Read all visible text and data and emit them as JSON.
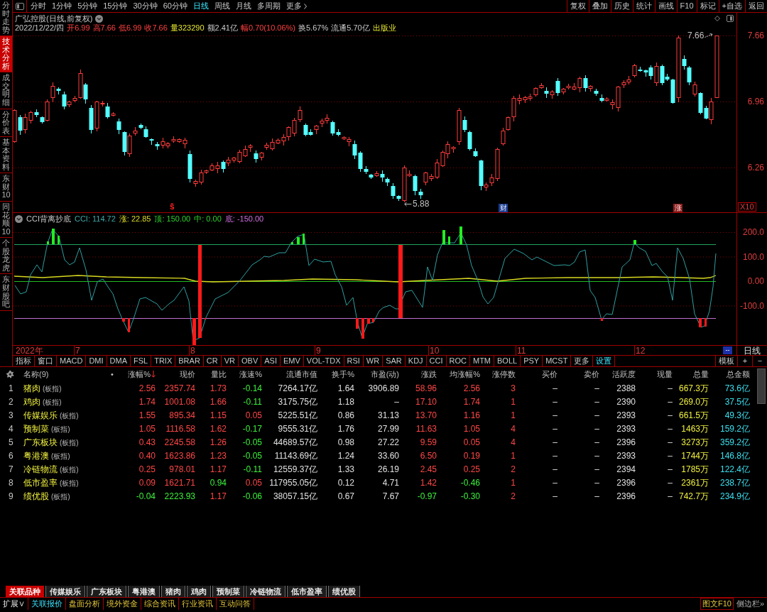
{
  "sidebar": {
    "items": [
      {
        "label": "分时走势",
        "selected": false
      },
      {
        "label": "技术分析",
        "selected": true
      },
      {
        "label": "成交明细",
        "selected": false
      },
      {
        "label": "分价表",
        "selected": false
      },
      {
        "label": "基本资料",
        "selected": false
      },
      {
        "label": "东财10",
        "selected": false
      },
      {
        "label": "同花顺10",
        "selected": false
      },
      {
        "label": "个股龙虎",
        "selected": false
      },
      {
        "label": "东财股吧",
        "selected": false
      }
    ]
  },
  "period_bar": {
    "periods": [
      {
        "label": "分时",
        "selected": false
      },
      {
        "label": "1分钟",
        "selected": false
      },
      {
        "label": "5分钟",
        "selected": false
      },
      {
        "label": "15分钟",
        "selected": false
      },
      {
        "label": "30分钟",
        "selected": false
      },
      {
        "label": "60分钟",
        "selected": false
      },
      {
        "label": "日线",
        "selected": true
      },
      {
        "label": "周线",
        "selected": false
      },
      {
        "label": "月线",
        "selected": false
      },
      {
        "label": "多周期",
        "selected": false
      }
    ],
    "more": "更多",
    "tools": [
      "复权",
      "叠加",
      "历史",
      "统计",
      "画线",
      "F10",
      "标记",
      "+自选",
      "返回"
    ]
  },
  "quote": {
    "title": "广弘控股(日线,前复权)",
    "date": "2022/12/22/四",
    "fields": [
      {
        "text": "开6.99",
        "kind": "up"
      },
      {
        "text": "高7.66",
        "kind": "up"
      },
      {
        "text": "低6.99",
        "kind": "up"
      },
      {
        "text": "收7.66",
        "kind": "up"
      },
      {
        "text": "量323290",
        "kind": "volume"
      },
      {
        "text": "额2.41亿",
        "kind": "plain"
      },
      {
        "text": "幅0.70(10.06%)",
        "kind": "up"
      },
      {
        "text": "换5.67%",
        "kind": "plain"
      },
      {
        "text": "流通5.70亿",
        "kind": "plain"
      },
      {
        "text": "出版业",
        "kind": "industry"
      }
    ]
  },
  "price_chart": {
    "axis": [
      "7.66",
      "6.96",
      "6.26"
    ],
    "high_label": "7.66",
    "low_label": "5.88",
    "markers": [
      {
        "text": "ŝ",
        "kind": "signal"
      },
      {
        "text": "财",
        "kind": "finance"
      },
      {
        "text": "涨",
        "kind": "rise"
      }
    ],
    "scale": "X10"
  },
  "indicator": {
    "name": "CCI背离抄底",
    "readings": [
      {
        "text": "CCI: 114.72",
        "kind": "cci"
      },
      {
        "text": "涨: 22.85",
        "kind": "rise"
      },
      {
        "text": "顶: 150.00",
        "kind": "top"
      },
      {
        "text": "中: 0.00",
        "kind": "middle"
      },
      {
        "text": "底: -150.00",
        "kind": "bottom"
      }
    ],
    "axis": [
      "200.0",
      "100.0",
      "0.00",
      "-100.0"
    ]
  },
  "time_axis": {
    "labels": [
      "2022年",
      "7",
      "8",
      "9",
      "10",
      "11",
      "12"
    ],
    "cursor": "--",
    "period": "日线"
  },
  "indicator_bar": {
    "tabs": [
      "指标",
      "窗口",
      "MACD",
      "DMI",
      "DMA",
      "FSL",
      "TRIX",
      "BRAR",
      "CR",
      "VR",
      "OBV",
      "ASI",
      "EMV",
      "VOL-TDX",
      "RSI",
      "WR",
      "SAR",
      "KDJ",
      "CCI",
      "ROC",
      "MTM",
      "BOLL",
      "PSY",
      "MCST",
      "更多"
    ],
    "settings": "设置",
    "right": [
      "模板",
      "+",
      "−"
    ]
  },
  "table": {
    "name_header": "名称(9)",
    "marker_header": "•",
    "columns": [
      {
        "label": "涨幅%",
        "sorted": true
      },
      {
        "label": "现价",
        "sorted": false
      },
      {
        "label": "量比",
        "sorted": false
      },
      {
        "label": "涨速%",
        "sorted": false
      },
      {
        "label": "流通市值",
        "sorted": false
      },
      {
        "label": "换手%",
        "sorted": false
      },
      {
        "label": "市盈(动)",
        "sorted": false
      },
      {
        "label": "涨跌",
        "sorted": false
      },
      {
        "label": "均涨幅%",
        "sorted": false
      },
      {
        "label": "涨停数",
        "sorted": false
      },
      {
        "label": "买价",
        "sorted": false
      },
      {
        "label": "卖价",
        "sorted": false
      },
      {
        "label": "活跃度",
        "sorted": false
      },
      {
        "label": "现量",
        "sorted": false
      },
      {
        "label": "总量",
        "sorted": false
      },
      {
        "label": "总金额",
        "sorted": false
      }
    ],
    "rows": [
      {
        "index": "1",
        "name": "猪肉",
        "tag": "(板指)",
        "cells": [
          {
            "text": "2.56",
            "kind": "up"
          },
          {
            "text": "2357.74",
            "kind": "up"
          },
          {
            "text": "1.73",
            "kind": "up"
          },
          {
            "text": "-0.14",
            "kind": "down"
          },
          {
            "text": "7264.17亿",
            "kind": "plain"
          },
          {
            "text": "1.64",
            "kind": "plain"
          },
          {
            "text": "3906.89",
            "kind": "plain"
          },
          {
            "text": "58.96",
            "kind": "up"
          },
          {
            "text": "2.56",
            "kind": "up"
          },
          {
            "text": "3",
            "kind": "up"
          },
          {
            "text": "–",
            "kind": "plain"
          },
          {
            "text": "–",
            "kind": "plain"
          },
          {
            "text": "2388",
            "kind": "plain"
          },
          {
            "text": "–",
            "kind": "plain"
          },
          {
            "text": "667.3万",
            "kind": "volume"
          },
          {
            "text": "73.6亿",
            "kind": "amount"
          }
        ]
      },
      {
        "index": "2",
        "name": "鸡肉",
        "tag": "(板指)",
        "cells": [
          {
            "text": "1.74",
            "kind": "up"
          },
          {
            "text": "1001.08",
            "kind": "up"
          },
          {
            "text": "1.66",
            "kind": "up"
          },
          {
            "text": "-0.11",
            "kind": "down"
          },
          {
            "text": "3175.75亿",
            "kind": "plain"
          },
          {
            "text": "1.18",
            "kind": "plain"
          },
          {
            "text": "–",
            "kind": "plain"
          },
          {
            "text": "17.10",
            "kind": "up"
          },
          {
            "text": "1.74",
            "kind": "up"
          },
          {
            "text": "1",
            "kind": "up"
          },
          {
            "text": "–",
            "kind": "plain"
          },
          {
            "text": "–",
            "kind": "plain"
          },
          {
            "text": "2390",
            "kind": "plain"
          },
          {
            "text": "–",
            "kind": "plain"
          },
          {
            "text": "269.0万",
            "kind": "volume"
          },
          {
            "text": "37.5亿",
            "kind": "amount"
          }
        ]
      },
      {
        "index": "3",
        "name": "传媒娱乐",
        "tag": "(板指)",
        "cells": [
          {
            "text": "1.55",
            "kind": "up"
          },
          {
            "text": "895.34",
            "kind": "up"
          },
          {
            "text": "1.15",
            "kind": "up"
          },
          {
            "text": "0.05",
            "kind": "up"
          },
          {
            "text": "5225.51亿",
            "kind": "plain"
          },
          {
            "text": "0.86",
            "kind": "plain"
          },
          {
            "text": "31.13",
            "kind": "plain"
          },
          {
            "text": "13.70",
            "kind": "up"
          },
          {
            "text": "1.16",
            "kind": "up"
          },
          {
            "text": "1",
            "kind": "up"
          },
          {
            "text": "–",
            "kind": "plain"
          },
          {
            "text": "–",
            "kind": "plain"
          },
          {
            "text": "2393",
            "kind": "plain"
          },
          {
            "text": "–",
            "kind": "plain"
          },
          {
            "text": "661.5万",
            "kind": "volume"
          },
          {
            "text": "49.3亿",
            "kind": "amount"
          }
        ]
      },
      {
        "index": "4",
        "name": "预制菜",
        "tag": "(板指)",
        "cells": [
          {
            "text": "1.05",
            "kind": "up"
          },
          {
            "text": "1116.58",
            "kind": "up"
          },
          {
            "text": "1.62",
            "kind": "up"
          },
          {
            "text": "-0.17",
            "kind": "down"
          },
          {
            "text": "9555.31亿",
            "kind": "plain"
          },
          {
            "text": "1.76",
            "kind": "plain"
          },
          {
            "text": "27.99",
            "kind": "plain"
          },
          {
            "text": "11.63",
            "kind": "up"
          },
          {
            "text": "1.05",
            "kind": "up"
          },
          {
            "text": "4",
            "kind": "up"
          },
          {
            "text": "–",
            "kind": "plain"
          },
          {
            "text": "–",
            "kind": "plain"
          },
          {
            "text": "2393",
            "kind": "plain"
          },
          {
            "text": "–",
            "kind": "plain"
          },
          {
            "text": "1463万",
            "kind": "volume"
          },
          {
            "text": "159.2亿",
            "kind": "amount"
          }
        ]
      },
      {
        "index": "5",
        "name": "广东板块",
        "tag": "(板指)",
        "cells": [
          {
            "text": "0.43",
            "kind": "up"
          },
          {
            "text": "2245.58",
            "kind": "up"
          },
          {
            "text": "1.26",
            "kind": "up"
          },
          {
            "text": "-0.05",
            "kind": "down"
          },
          {
            "text": "44689.57亿",
            "kind": "plain"
          },
          {
            "text": "0.98",
            "kind": "plain"
          },
          {
            "text": "27.22",
            "kind": "plain"
          },
          {
            "text": "9.59",
            "kind": "up"
          },
          {
            "text": "0.05",
            "kind": "up"
          },
          {
            "text": "4",
            "kind": "up"
          },
          {
            "text": "–",
            "kind": "plain"
          },
          {
            "text": "–",
            "kind": "plain"
          },
          {
            "text": "2396",
            "kind": "plain"
          },
          {
            "text": "–",
            "kind": "plain"
          },
          {
            "text": "3273万",
            "kind": "volume"
          },
          {
            "text": "359.2亿",
            "kind": "amount"
          }
        ]
      },
      {
        "index": "6",
        "name": "粤港澳",
        "tag": "(板指)",
        "cells": [
          {
            "text": "0.40",
            "kind": "up"
          },
          {
            "text": "1623.86",
            "kind": "up"
          },
          {
            "text": "1.23",
            "kind": "up"
          },
          {
            "text": "-0.05",
            "kind": "down"
          },
          {
            "text": "11143.69亿",
            "kind": "plain"
          },
          {
            "text": "1.24",
            "kind": "plain"
          },
          {
            "text": "33.60",
            "kind": "plain"
          },
          {
            "text": "6.50",
            "kind": "up"
          },
          {
            "text": "0.19",
            "kind": "up"
          },
          {
            "text": "1",
            "kind": "up"
          },
          {
            "text": "–",
            "kind": "plain"
          },
          {
            "text": "–",
            "kind": "plain"
          },
          {
            "text": "2393",
            "kind": "plain"
          },
          {
            "text": "–",
            "kind": "plain"
          },
          {
            "text": "1744万",
            "kind": "volume"
          },
          {
            "text": "146.8亿",
            "kind": "amount"
          }
        ]
      },
      {
        "index": "7",
        "name": "冷链物流",
        "tag": "(板指)",
        "cells": [
          {
            "text": "0.25",
            "kind": "up"
          },
          {
            "text": "978.01",
            "kind": "up"
          },
          {
            "text": "1.17",
            "kind": "up"
          },
          {
            "text": "-0.11",
            "kind": "down"
          },
          {
            "text": "12559.37亿",
            "kind": "plain"
          },
          {
            "text": "1.33",
            "kind": "plain"
          },
          {
            "text": "26.19",
            "kind": "plain"
          },
          {
            "text": "2.45",
            "kind": "up"
          },
          {
            "text": "0.25",
            "kind": "up"
          },
          {
            "text": "2",
            "kind": "up"
          },
          {
            "text": "–",
            "kind": "plain"
          },
          {
            "text": "–",
            "kind": "plain"
          },
          {
            "text": "2394",
            "kind": "plain"
          },
          {
            "text": "–",
            "kind": "plain"
          },
          {
            "text": "1785万",
            "kind": "volume"
          },
          {
            "text": "122.4亿",
            "kind": "amount"
          }
        ]
      },
      {
        "index": "8",
        "name": "低市盈率",
        "tag": "(板指)",
        "cells": [
          {
            "text": "0.09",
            "kind": "up"
          },
          {
            "text": "1621.71",
            "kind": "up"
          },
          {
            "text": "0.94",
            "kind": "down"
          },
          {
            "text": "0.05",
            "kind": "up"
          },
          {
            "text": "117955.05亿",
            "kind": "plain"
          },
          {
            "text": "0.12",
            "kind": "plain"
          },
          {
            "text": "4.71",
            "kind": "plain"
          },
          {
            "text": "1.42",
            "kind": "up"
          },
          {
            "text": "-0.46",
            "kind": "down"
          },
          {
            "text": "1",
            "kind": "up"
          },
          {
            "text": "–",
            "kind": "plain"
          },
          {
            "text": "–",
            "kind": "plain"
          },
          {
            "text": "2396",
            "kind": "plain"
          },
          {
            "text": "–",
            "kind": "plain"
          },
          {
            "text": "2361万",
            "kind": "volume"
          },
          {
            "text": "238.7亿",
            "kind": "amount"
          }
        ]
      },
      {
        "index": "9",
        "name": "绩优股",
        "tag": "(板指)",
        "cells": [
          {
            "text": "-0.04",
            "kind": "down"
          },
          {
            "text": "2223.93",
            "kind": "down"
          },
          {
            "text": "1.17",
            "kind": "up"
          },
          {
            "text": "-0.06",
            "kind": "down"
          },
          {
            "text": "38057.15亿",
            "kind": "plain"
          },
          {
            "text": "0.67",
            "kind": "plain"
          },
          {
            "text": "7.67",
            "kind": "plain"
          },
          {
            "text": "-0.97",
            "kind": "down"
          },
          {
            "text": "-0.30",
            "kind": "down"
          },
          {
            "text": "2",
            "kind": "up"
          },
          {
            "text": "–",
            "kind": "plain"
          },
          {
            "text": "–",
            "kind": "plain"
          },
          {
            "text": "2396",
            "kind": "plain"
          },
          {
            "text": "–",
            "kind": "plain"
          },
          {
            "text": "742.7万",
            "kind": "volume"
          },
          {
            "text": "234.9亿",
            "kind": "amount"
          }
        ]
      }
    ]
  },
  "bottom_tabs": [
    {
      "label": "关联品种",
      "selected": true
    },
    {
      "label": "传媒娱乐",
      "selected": false
    },
    {
      "label": "广东板块",
      "selected": false
    },
    {
      "label": "粤港澳",
      "selected": false
    },
    {
      "label": "猪肉",
      "selected": false
    },
    {
      "label": "鸡肉",
      "selected": false
    },
    {
      "label": "预制菜",
      "selected": false
    },
    {
      "label": "冷链物流",
      "selected": false
    },
    {
      "label": "低市盈率",
      "selected": false
    },
    {
      "label": "绩优股",
      "selected": false
    }
  ],
  "status_bar": {
    "menu": "扩展∨",
    "links": [
      {
        "label": "关联报价",
        "selected": true
      },
      {
        "label": "盘面分析",
        "selected": false
      },
      {
        "label": "境外资金",
        "selected": false
      },
      {
        "label": "综合资讯",
        "selected": false
      },
      {
        "label": "行业资讯",
        "selected": false
      },
      {
        "label": "互动问答",
        "selected": false
      }
    ],
    "f10": "图文F10",
    "sidebar_toggle": "侧边栏»"
  }
}
